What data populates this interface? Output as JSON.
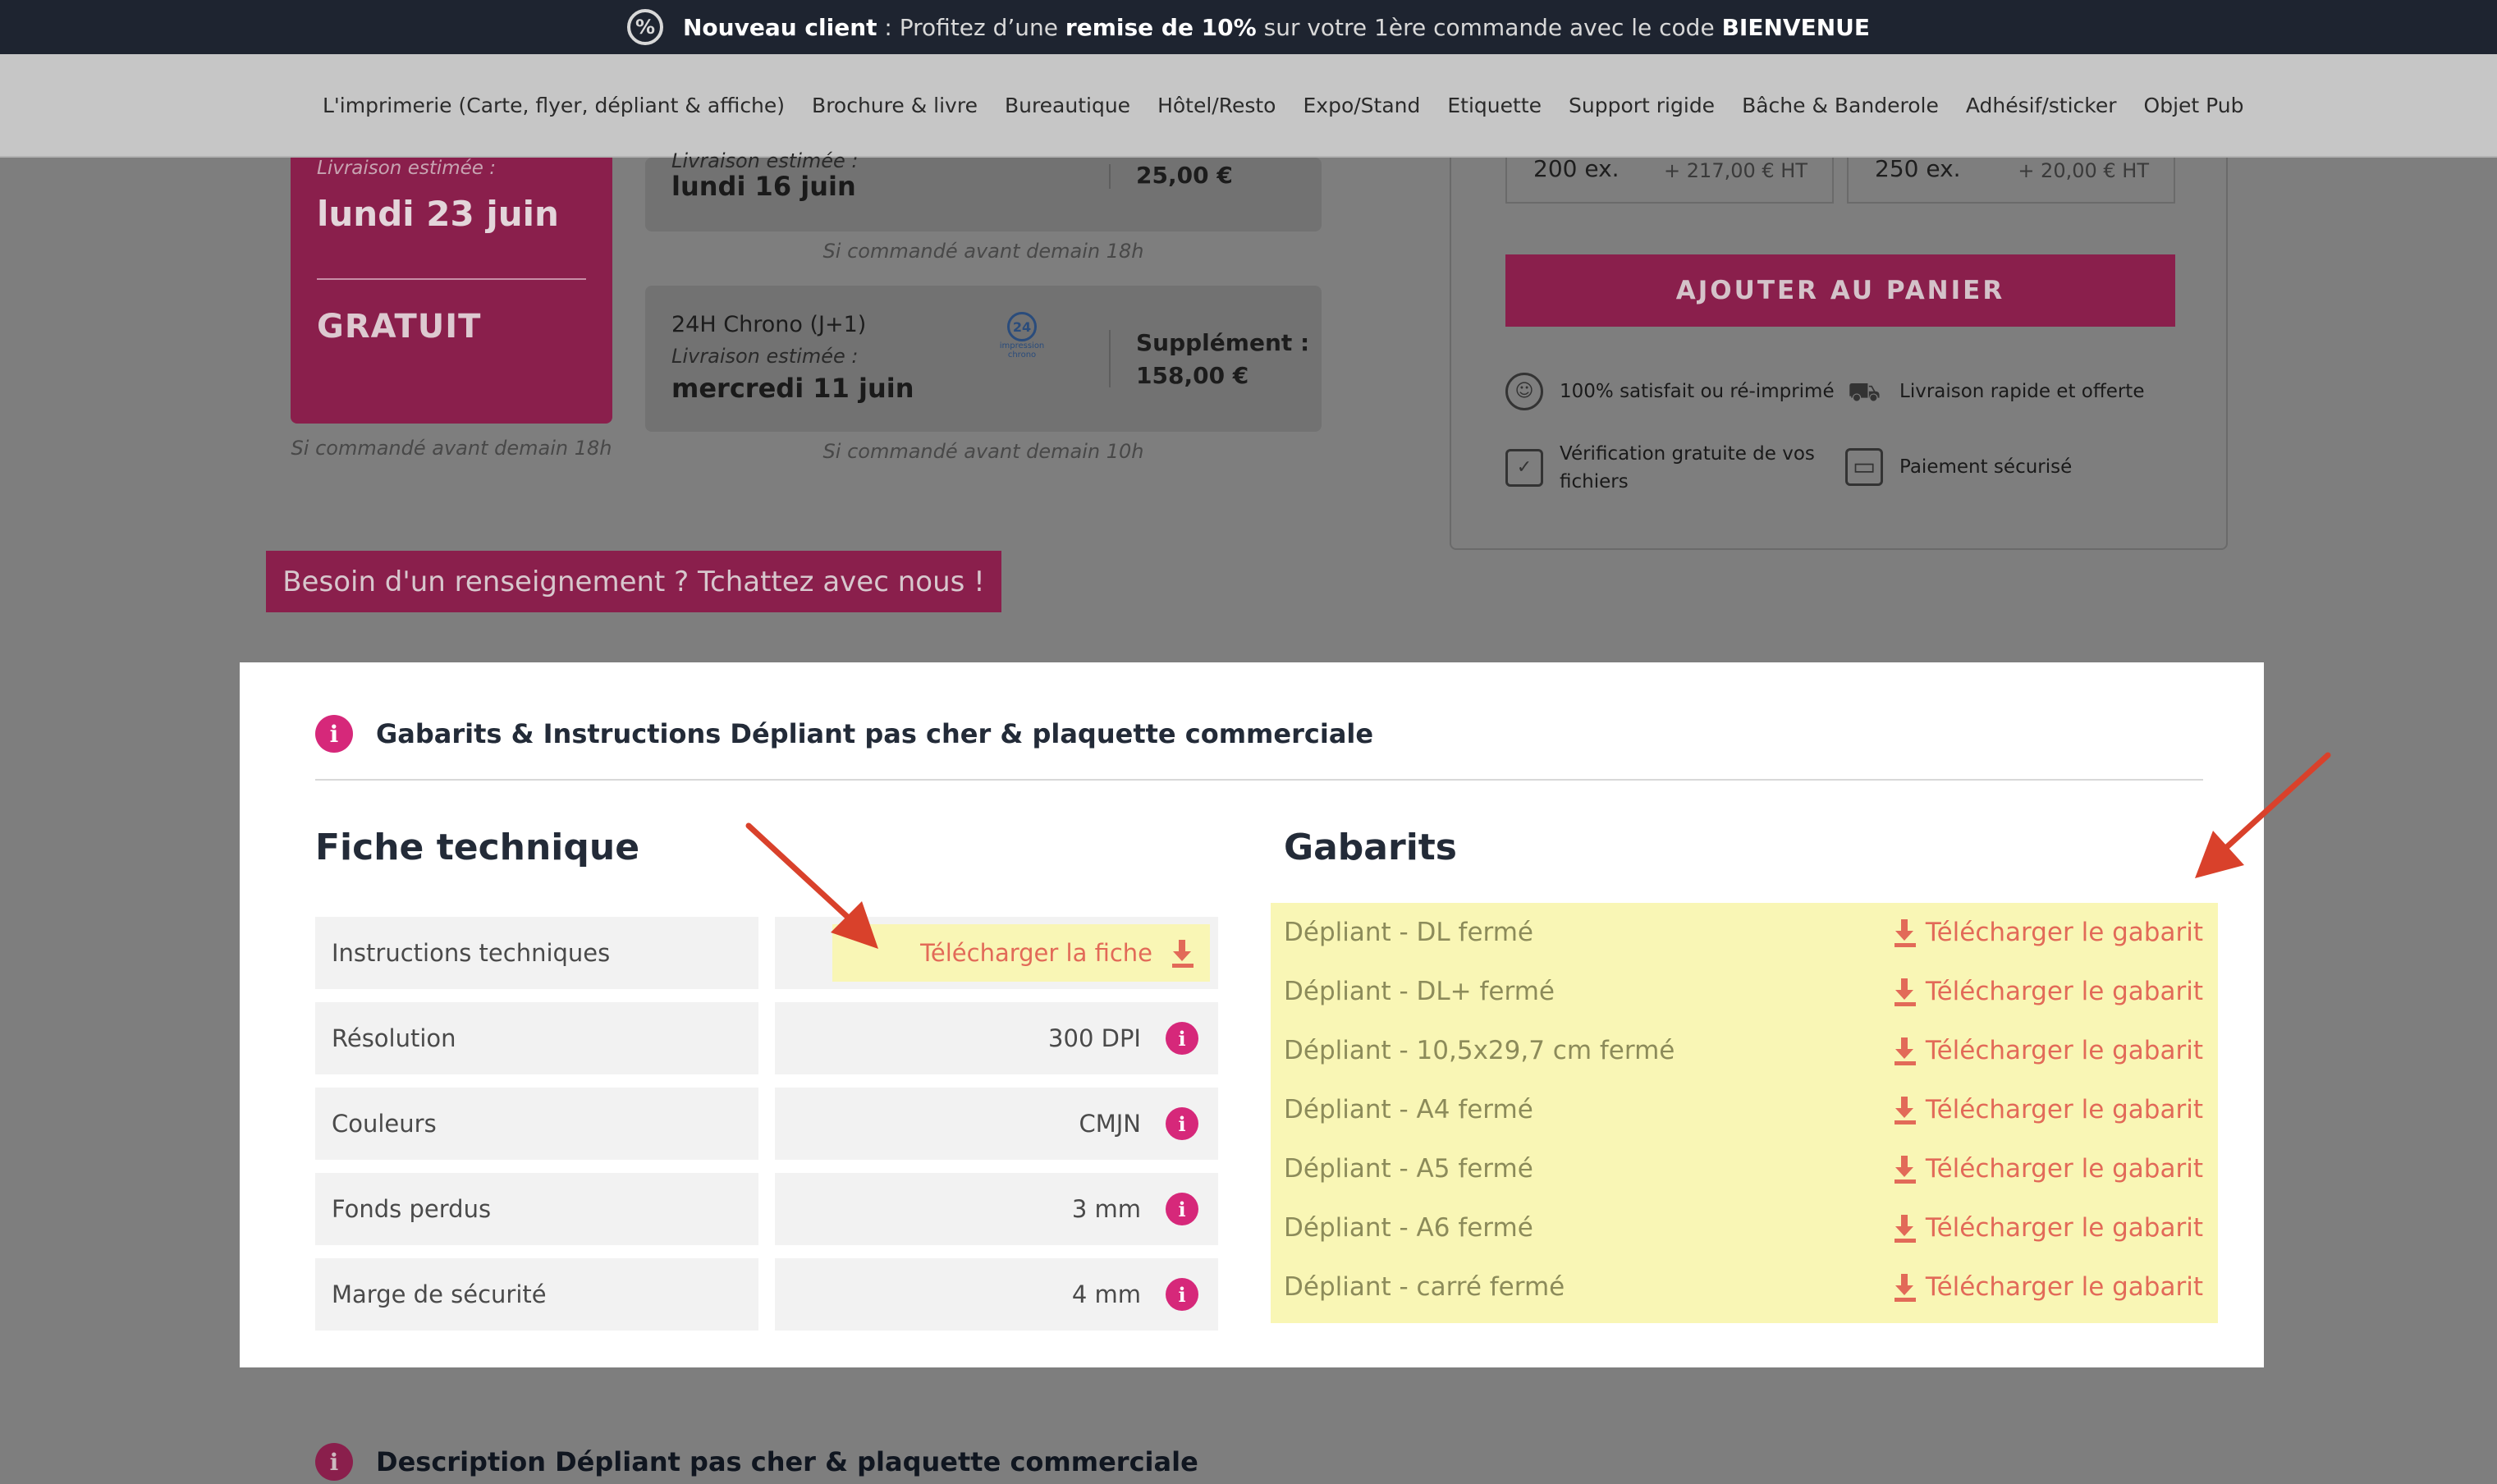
{
  "promo": {
    "badge": "%",
    "lead": "Nouveau client",
    "text1": ": Profitez d’une",
    "discount": "remise de 10%",
    "text2": "sur votre 1ère commande avec le code",
    "code": "BIENVENUE"
  },
  "nav": {
    "items": [
      "L'imprimerie (Carte, flyer, dépliant & affiche)",
      "Brochure & livre",
      "Bureautique",
      "Hôtel/Resto",
      "Expo/Stand",
      "Etiquette",
      "Support rigide",
      "Bâche & Banderole",
      "Adhésif/sticker",
      "Objet Pub"
    ]
  },
  "delivery": {
    "free_option": {
      "label": "Livraison estimée :",
      "date": "lundi 23 juin",
      "price": "GRATUIT",
      "note": "Si commandé avant demain 18h"
    },
    "express_option": {
      "label": "Livraison estimée :",
      "date": "lundi 16 juin",
      "price": "25,00 €",
      "note": "Si commandé avant demain 18h"
    },
    "chrono_option": {
      "name": "24H Chrono (J+1)",
      "label": "Livraison estimée :",
      "date": "mercredi 11 juin",
      "price_label": "Supplément :",
      "price": "158,00 €",
      "note": "Si commandé avant demain 10h",
      "logo_number": "24",
      "logo_line1": "impression",
      "logo_line2": "chrono"
    }
  },
  "chat_button": "Besoin d'un renseignement ? Tchattez avec nous !",
  "order": {
    "quantities": [
      {
        "qty": "200 ex.",
        "price": "+ 217,00 € HT"
      },
      {
        "qty": "250 ex.",
        "price": "+ 20,00 € HT"
      }
    ],
    "add_to_cart": "AJOUTER AU PANIER",
    "features": [
      {
        "icon": "smiley-icon",
        "glyph": "☺",
        "text": "100% satisfait ou ré-imprimé"
      },
      {
        "icon": "truck-icon",
        "glyph": "⛟",
        "text": "Livraison rapide et offerte"
      },
      {
        "icon": "file-check-icon",
        "glyph": "✓",
        "text_line1": "Vérification gratuite de vos",
        "text_line2": "fichiers"
      },
      {
        "icon": "credit-card-icon",
        "glyph": "▭",
        "text": "Paiement sécurisé"
      }
    ]
  },
  "templates_section": {
    "title": "Gabarits & Instructions Dépliant pas cher & plaquette commerciale",
    "spec_title": "Fiche technique",
    "spec_rows": [
      {
        "label": "Instructions techniques",
        "value": "Télécharger la fiche"
      },
      {
        "label": "Résolution",
        "value": "300 DPI"
      },
      {
        "label": "Couleurs",
        "value": "CMJN"
      },
      {
        "label": "Fonds perdus",
        "value": "3 mm"
      },
      {
        "label": "Marge de sécurité",
        "value": "4 mm"
      }
    ],
    "templates_title": "Gabarits",
    "templates": [
      {
        "name": "Dépliant - DL fermé",
        "link": "Télécharger le gabarit"
      },
      {
        "name": "Dépliant - DL+ fermé",
        "link": "Télécharger le gabarit"
      },
      {
        "name": "Dépliant - 10,5x29,7 cm fermé",
        "link": "Télécharger le gabarit"
      },
      {
        "name": "Dépliant - A4 fermé",
        "link": "Télécharger le gabarit"
      },
      {
        "name": "Dépliant - A5 fermé",
        "link": "Télécharger le gabarit"
      },
      {
        "name": "Dépliant - A6 fermé",
        "link": "Télécharger le gabarit"
      },
      {
        "name": "Dépliant - carré fermé",
        "link": "Télécharger le gabarit"
      }
    ]
  },
  "description_section": {
    "title": "Description Dépliant pas cher & plaquette commerciale"
  },
  "info_glyph": "i",
  "colors": {
    "brand": "#d6287a",
    "brand_dimmed": "#8a1f4c",
    "highlight": "#f9f6b5",
    "link": "#e26a58",
    "arrow": "#d9412b"
  }
}
